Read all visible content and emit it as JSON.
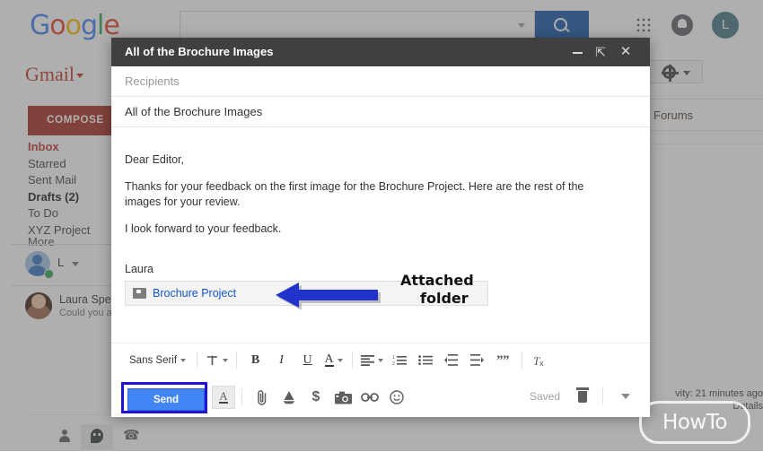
{
  "browser": {
    "google_logo": "Google",
    "search_placeholder": "",
    "search_value": "",
    "search_icon": "search-icon",
    "apps_icon": "apps-grid-icon",
    "notifications_icon": "bell-icon",
    "account_initial": "L"
  },
  "gmail": {
    "brand": "Gmail",
    "compose_label": "COMPOSE",
    "nav": [
      {
        "label": "Inbox",
        "state": "active"
      },
      {
        "label": "Starred",
        "state": "normal"
      },
      {
        "label": "Sent Mail",
        "state": "normal"
      },
      {
        "label": "Drafts (2)",
        "state": "bold"
      },
      {
        "label": "To Do",
        "state": "normal"
      },
      {
        "label": "XYZ Project",
        "state": "normal"
      },
      {
        "label": "More",
        "state": "cut"
      }
    ],
    "hangouts_user": "L",
    "chat_contact": {
      "name": "Laura Sper",
      "snippet": "Could you as"
    },
    "tabs": [
      {
        "label": "Forums"
      }
    ],
    "settings_icon": "gear-icon",
    "footer": {
      "activity": "vity: 21 minutes ago",
      "details": "Details"
    },
    "bottom_icons": [
      {
        "name": "contacts-icon",
        "glyph": "person"
      },
      {
        "name": "hangouts-icon",
        "glyph": "hangouts"
      },
      {
        "name": "phone-icon",
        "glyph": "phone"
      }
    ]
  },
  "compose": {
    "window_title": "All of the Brochure Images",
    "controls": {
      "minimize": "minimize-icon",
      "fullscreen": "fullscreen-icon",
      "close": "close-icon"
    },
    "recipients_placeholder": "Recipients",
    "recipients_value": "",
    "subject_value": "All of the Brochure Images",
    "body": {
      "line1": "Dear Editor,",
      "line2": "Thanks for your feedback on the first image for the Brochure Project. Here are the rest of the images for your review.",
      "line3": "I look forward to your feedback.",
      "line4": "Laura"
    },
    "attachment": {
      "icon": "folder-icon",
      "label": "Brochure Project"
    },
    "annotation": {
      "line1": "Attached",
      "line2": "folder",
      "arrow": "left-arrow"
    },
    "format_toolbar": {
      "font_family": "Sans Serif",
      "items": [
        {
          "name": "font-family-select",
          "label": "Sans Serif",
          "caret": true
        },
        {
          "name": "font-size-button",
          "label": "↑T",
          "caret": true
        },
        {
          "name": "bold-button",
          "label": "B"
        },
        {
          "name": "italic-button",
          "label": "I"
        },
        {
          "name": "underline-button",
          "label": "U"
        },
        {
          "name": "text-color-button",
          "label": "A",
          "caret": true
        },
        {
          "name": "align-button",
          "label": "≡",
          "caret": true
        },
        {
          "name": "numbered-list-button",
          "label": "list"
        },
        {
          "name": "bulleted-list-button",
          "label": "list"
        },
        {
          "name": "indent-less-button",
          "label": "indent"
        },
        {
          "name": "indent-more-button",
          "label": "indent"
        },
        {
          "name": "quote-button",
          "label": "”"
        },
        {
          "name": "remove-formatting-button",
          "label": "Tx"
        }
      ]
    },
    "send_label": "Send",
    "action_icons": [
      {
        "name": "formatting-options-icon",
        "glyph": "A"
      },
      {
        "name": "attach-file-icon",
        "glyph": "paperclip"
      },
      {
        "name": "insert-drive-icon",
        "glyph": "drive"
      },
      {
        "name": "insert-money-icon",
        "glyph": "$"
      },
      {
        "name": "insert-photo-icon",
        "glyph": "camera"
      },
      {
        "name": "insert-link-icon",
        "glyph": "link"
      },
      {
        "name": "insert-emoji-icon",
        "glyph": "emoji"
      }
    ],
    "saved_status": "Saved",
    "discard_icon": "trash-icon",
    "more-options_icon": "more-options-caret"
  },
  "watermark": {
    "text": "HowTo"
  },
  "colors": {
    "header_dark": "#404040",
    "send_blue": "#4285f4",
    "highlight_blue": "#1f14d6",
    "link_blue": "#1155cc",
    "gmail_red": "#a93226",
    "arrow_blue": "#2233cc"
  }
}
